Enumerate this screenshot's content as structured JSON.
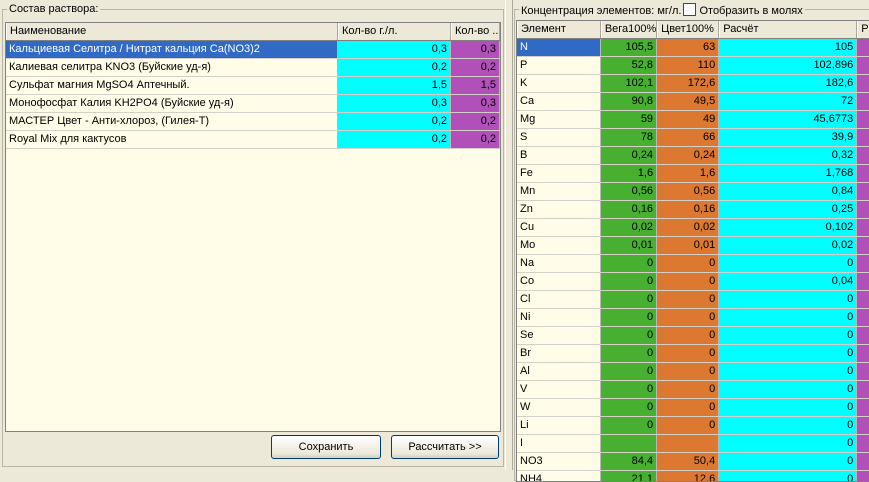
{
  "left": {
    "group_title": "Состав раствора:",
    "columns": [
      "Наименование",
      "Кол-во г./л.",
      "Кол-во ..."
    ],
    "rows": [
      {
        "name": "Кальциевая Селитра / Нитрат кальция Ca(NO3)2",
        "qty": "0,3",
        "qty2": "0,3",
        "selected": true
      },
      {
        "name": "Калиевая селитра KNO3 (Буйские уд-я)",
        "qty": "0,2",
        "qty2": "0,2",
        "selected": false
      },
      {
        "name": "Сульфат магния MgSO4 Аптечный.",
        "qty": "1,5",
        "qty2": "1,5",
        "selected": false
      },
      {
        "name": "Монофосфат Калия KH2PO4 (Буйские уд-я)",
        "qty": "0,3",
        "qty2": "0,3",
        "selected": false
      },
      {
        "name": "МАСТЕР Цвет - Анти-хлороз, (Гилея-Т)",
        "qty": "0,2",
        "qty2": "0,2",
        "selected": false
      },
      {
        "name": "Royal Mix для кактусов",
        "qty": "0,2",
        "qty2": "0,2",
        "selected": false
      }
    ],
    "save_label": "Сохранить",
    "calc_label": "Рассчитать >>"
  },
  "right": {
    "group_title": "Концентрация элементов: мг/л.",
    "show_moles_label": "Отобразить в молях",
    "columns": [
      "Элемент",
      "Вега100%",
      "Цвет100%",
      "Расчёт",
      "Р"
    ],
    "rows": [
      {
        "el": "N",
        "vega": "105,5",
        "cvet": "63",
        "calc": "105",
        "selected": true
      },
      {
        "el": "P",
        "vega": "52,8",
        "cvet": "110",
        "calc": "102,896"
      },
      {
        "el": "K",
        "vega": "102,1",
        "cvet": "172,6",
        "calc": "182,6"
      },
      {
        "el": "Ca",
        "vega": "90,8",
        "cvet": "49,5",
        "calc": "72"
      },
      {
        "el": "Mg",
        "vega": "59",
        "cvet": "49",
        "calc": "45,6773"
      },
      {
        "el": "S",
        "vega": "78",
        "cvet": "66",
        "calc": "39,9"
      },
      {
        "el": "B",
        "vega": "0,24",
        "cvet": "0,24",
        "calc": "0,32"
      },
      {
        "el": "Fe",
        "vega": "1,6",
        "cvet": "1,6",
        "calc": "1,768"
      },
      {
        "el": "Mn",
        "vega": "0,56",
        "cvet": "0,56",
        "calc": "0,84"
      },
      {
        "el": "Zn",
        "vega": "0,16",
        "cvet": "0,16",
        "calc": "0,25"
      },
      {
        "el": "Cu",
        "vega": "0,02",
        "cvet": "0,02",
        "calc": "0,102"
      },
      {
        "el": "Mo",
        "vega": "0,01",
        "cvet": "0,01",
        "calc": "0,02"
      },
      {
        "el": "Na",
        "vega": "0",
        "cvet": "0",
        "calc": "0"
      },
      {
        "el": "Co",
        "vega": "0",
        "cvet": "0",
        "calc": "0,04"
      },
      {
        "el": "Cl",
        "vega": "0",
        "cvet": "0",
        "calc": "0"
      },
      {
        "el": "Ni",
        "vega": "0",
        "cvet": "0",
        "calc": "0"
      },
      {
        "el": "Se",
        "vega": "0",
        "cvet": "0",
        "calc": "0"
      },
      {
        "el": "Br",
        "vega": "0",
        "cvet": "0",
        "calc": "0"
      },
      {
        "el": "Al",
        "vega": "0",
        "cvet": "0",
        "calc": "0"
      },
      {
        "el": "V",
        "vega": "0",
        "cvet": "0",
        "calc": "0"
      },
      {
        "el": "W",
        "vega": "0",
        "cvet": "0",
        "calc": "0"
      },
      {
        "el": "Li",
        "vega": "0",
        "cvet": "0",
        "calc": "0"
      },
      {
        "el": "I",
        "vega": "",
        "cvet": "",
        "calc": "0"
      },
      {
        "el": "NO3",
        "vega": "84,4",
        "cvet": "50,4",
        "calc": "0"
      },
      {
        "el": "NH4",
        "vega": "21,1",
        "cvet": "12,6",
        "calc": "0"
      }
    ]
  },
  "colors": {
    "cyan": "#00ffff",
    "purple": "#b050b8",
    "green": "#48b030",
    "orange": "#dc7830",
    "selection": "#316ac5"
  }
}
